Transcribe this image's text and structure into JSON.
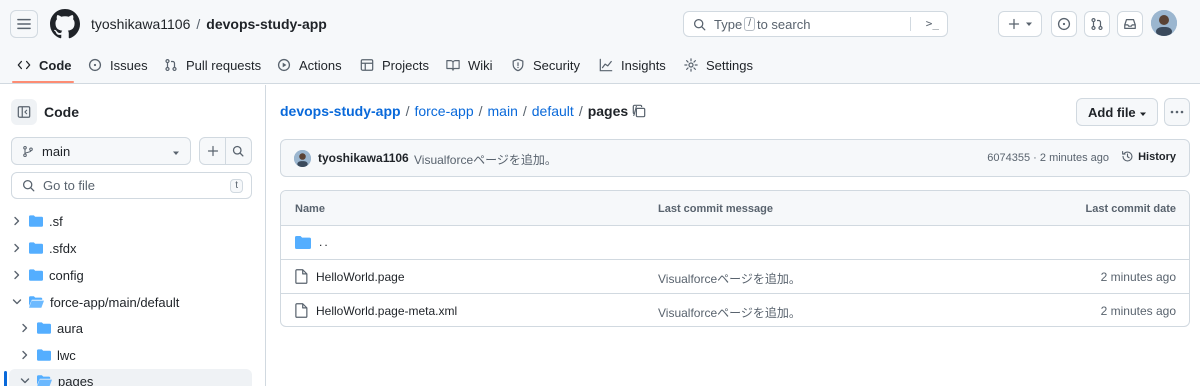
{
  "header": {
    "owner": "tyoshikawa1106",
    "separator": "/",
    "repo": "devops-study-app",
    "search_prefix": "Type",
    "search_key": "/",
    "search_suffix": "to search",
    "command_palette": ">_"
  },
  "repo_nav": {
    "tabs": [
      {
        "label": "Code",
        "icon": "code-icon",
        "active": true
      },
      {
        "label": "Issues",
        "icon": "issue-icon"
      },
      {
        "label": "Pull requests",
        "icon": "pull-request-icon"
      },
      {
        "label": "Actions",
        "icon": "play-icon"
      },
      {
        "label": "Projects",
        "icon": "table-icon"
      },
      {
        "label": "Wiki",
        "icon": "book-icon"
      },
      {
        "label": "Security",
        "icon": "shield-icon"
      },
      {
        "label": "Insights",
        "icon": "graph-icon"
      },
      {
        "label": "Settings",
        "icon": "gear-icon"
      }
    ],
    "accent": "#fd8c73"
  },
  "sidebar": {
    "title": "Code",
    "branch": "main",
    "goto_placeholder": "Go to file",
    "goto_shortcut": "t",
    "tree": [
      {
        "label": ".sf",
        "expanded": false
      },
      {
        "label": ".sfdx",
        "expanded": false
      },
      {
        "label": "config",
        "expanded": false
      },
      {
        "label": "force-app/main/default",
        "expanded": true
      },
      {
        "label": "aura",
        "expanded": false
      },
      {
        "label": "lwc",
        "expanded": false
      },
      {
        "label": "pages",
        "expanded": true,
        "selected": true
      }
    ]
  },
  "main": {
    "breadcrumb": {
      "repo": "devops-study-app",
      "parts": [
        "force-app",
        "main",
        "default"
      ],
      "current": "pages",
      "trailing": "/"
    },
    "add_file_label": "Add file",
    "commit": {
      "author": "tyoshikawa1106",
      "message": "Visualforceページを追加。",
      "sha_and_time": "6074355 · 2 minutes ago",
      "history_label": "History"
    },
    "table": {
      "headers": {
        "name": "Name",
        "message": "Last commit message",
        "date": "Last commit date"
      },
      "parent_dir": "..",
      "rows": [
        {
          "name": "HelloWorld.page",
          "message": "Visualforceページを追加。",
          "date": "2 minutes ago"
        },
        {
          "name": "HelloWorld.page-meta.xml",
          "message": "Visualforceページを追加。",
          "date": "2 minutes ago"
        }
      ]
    }
  },
  "colors": {
    "link": "#0969da",
    "folder": "#54aeff",
    "muted": "#59636e",
    "border": "#d1d9e0"
  }
}
